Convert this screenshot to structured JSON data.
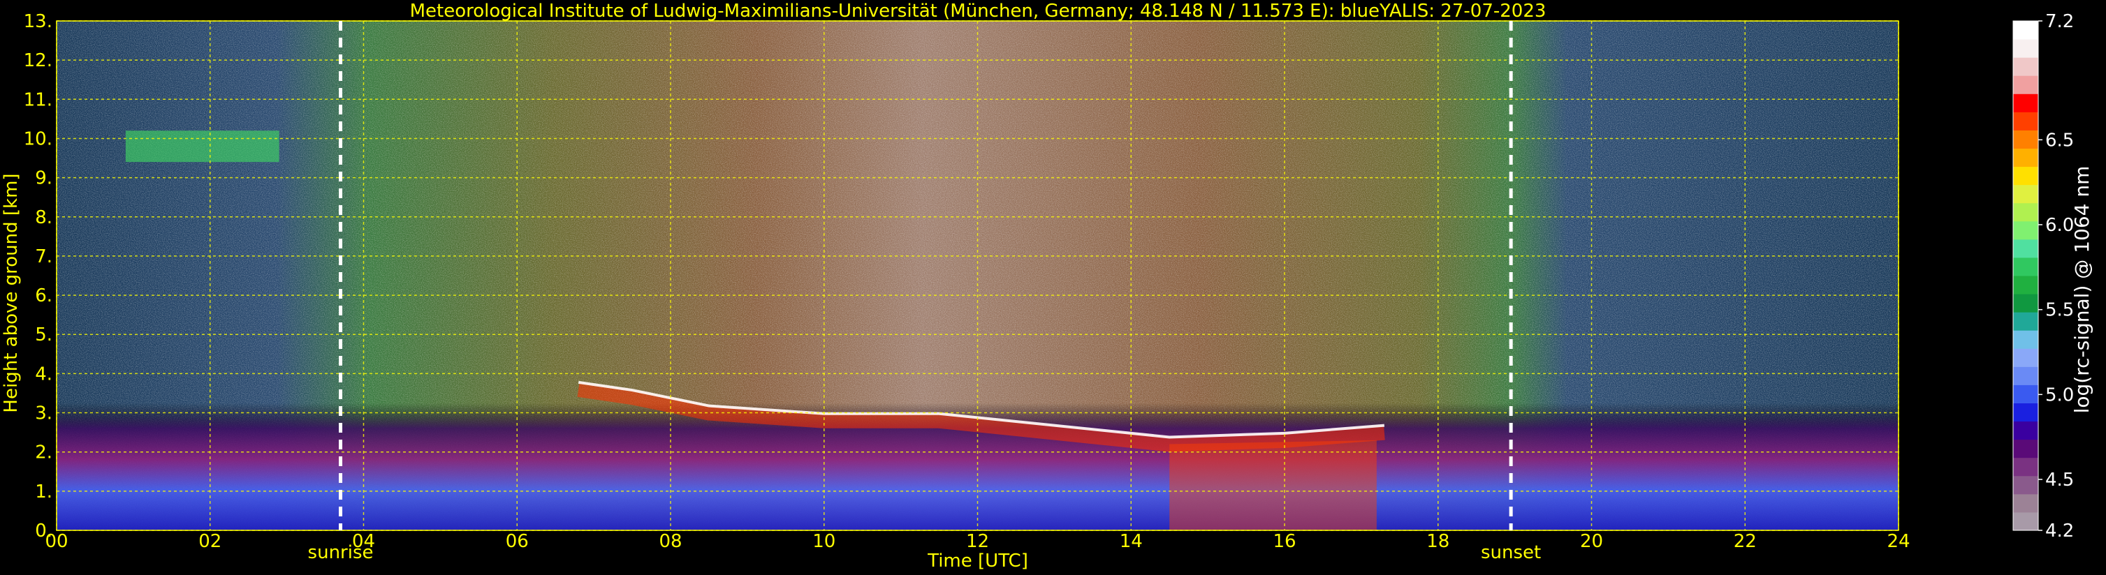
{
  "chart_data": {
    "type": "heatmap",
    "title": "Meteorological Institute of Ludwig-Maximilians-Universität (München, Germany; 48.148 N / 11.573 E):    blueYALIS: 27-07-2023",
    "xlabel": "Time [UTC]",
    "ylabel": "Height above ground [km]",
    "xlim": [
      0,
      24
    ],
    "ylim": [
      0,
      13
    ],
    "x_ticks": [
      "00",
      "02",
      "04",
      "06",
      "08",
      "10",
      "12",
      "14",
      "16",
      "18",
      "20",
      "22",
      "24"
    ],
    "y_ticks": [
      "0.",
      "1.",
      "2.",
      "3.",
      "4.",
      "5.",
      "6.",
      "7.",
      "8.",
      "9.",
      "10.",
      "11.",
      "12.",
      "13."
    ],
    "grid": true,
    "markers": [
      {
        "label": "sunrise",
        "x": 3.7
      },
      {
        "label": "sunset",
        "x": 18.95
      }
    ],
    "colorbar": {
      "label": "log(rc-signal) @ 1064 nm",
      "range": [
        4.2,
        7.2
      ],
      "ticks": [
        "7.2",
        "6.5",
        "6.0",
        "5.5",
        "5.0",
        "4.5",
        "4.2"
      ],
      "colors": [
        "#a89aa8",
        "#9c8296",
        "#8a5a8c",
        "#7a3282",
        "#5a0a78",
        "#3a00a0",
        "#1a20e0",
        "#3a5af0",
        "#6a8af5",
        "#8aa8f8",
        "#70c0e8",
        "#20a898",
        "#109840",
        "#20b040",
        "#30c860",
        "#50e0a0",
        "#80f070",
        "#b0f050",
        "#e0f040",
        "#ffe000",
        "#ffb000",
        "#ff8000",
        "#ff4000",
        "#ff0000",
        "#f0a0a0",
        "#f0c8c8",
        "#f8f0f0",
        "#ffffff"
      ]
    }
  }
}
